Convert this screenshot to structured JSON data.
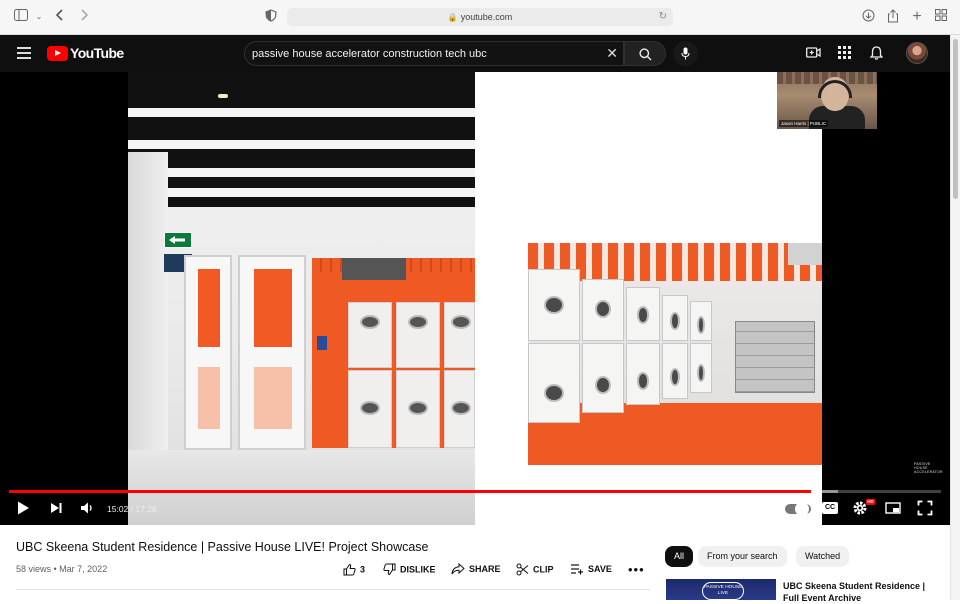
{
  "browser": {
    "address": "youtube.com"
  },
  "youtube": {
    "logo_text": "YouTube",
    "search_query": "passive house accelerator construction tech ubc"
  },
  "player": {
    "current_time": "15:02",
    "duration": "17:28",
    "played_fraction": 0.86,
    "buffered_fraction": 0.89,
    "webcam_name": "Jason Harris | PUBLIC",
    "watermark": "PASSIVE HOUSE ACCELERATOR",
    "cc_label": "CC",
    "hd_label": "HD"
  },
  "video": {
    "title": "UBC Skeena Student Residence | Passive House LIVE! Project Showcase",
    "meta": "58 views • Mar 7, 2022",
    "likes": "3",
    "dislike_label": "DISLIKE",
    "share_label": "SHARE",
    "clip_label": "CLIP",
    "save_label": "SAVE",
    "more_label": "•••"
  },
  "sidebar": {
    "chips": [
      "All",
      "From your search",
      "Watched"
    ],
    "recommendation": {
      "title": "UBC Skeena Student Residence | Full Event Archive",
      "thumb_text": "PASSIVE HOUSE LIVE"
    }
  },
  "colors": {
    "yt_red": "#ff0000",
    "header_bg": "#0f0f0f",
    "accent_orange": "#ef5a24"
  }
}
